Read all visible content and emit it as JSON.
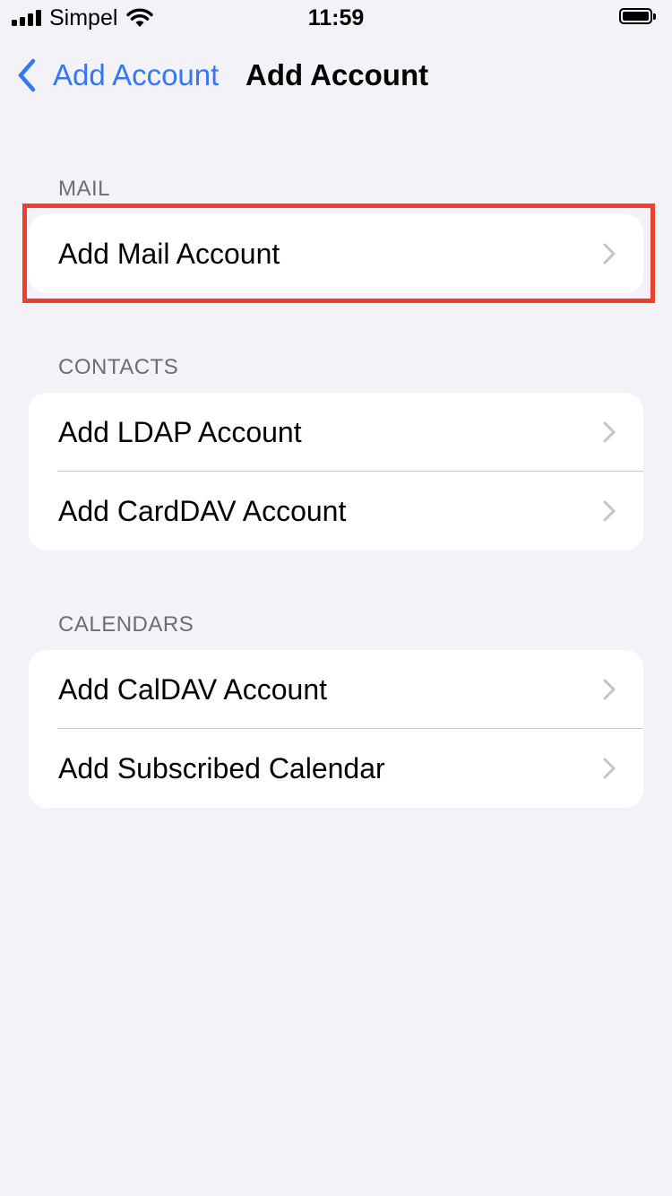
{
  "status_bar": {
    "carrier": "Simpel",
    "time": "11:59",
    "signal_icon": "cellular-signal-icon",
    "wifi_icon": "wifi-icon",
    "battery_icon": "battery-icon"
  },
  "nav": {
    "back_label": "Add Account",
    "title": "Add Account",
    "back_icon": "chevron-left-icon"
  },
  "sections": [
    {
      "header": "MAIL",
      "rows": [
        {
          "label": "Add Mail Account"
        }
      ]
    },
    {
      "header": "CONTACTS",
      "rows": [
        {
          "label": "Add LDAP Account"
        },
        {
          "label": "Add CardDAV Account"
        }
      ]
    },
    {
      "header": "CALENDARS",
      "rows": [
        {
          "label": "Add CalDAV Account"
        },
        {
          "label": "Add Subscribed Calendar"
        }
      ]
    }
  ],
  "colors": {
    "background": "#f2f2f7",
    "accent": "#3478f6",
    "highlight": "#e8412c",
    "section_header": "#6d6d72",
    "chevron": "#c4c4c6"
  }
}
